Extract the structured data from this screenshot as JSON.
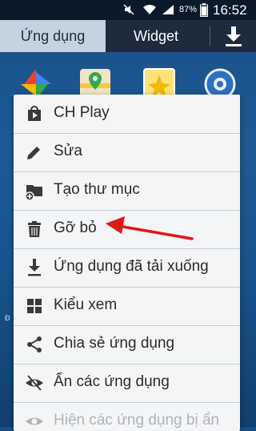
{
  "status_bar": {
    "battery_percent": "87%",
    "time": "16:52",
    "icons": [
      "mute-icon",
      "wifi-icon",
      "signal-icon",
      "battery-icon"
    ]
  },
  "tabs": [
    {
      "label": "Ứng dụng",
      "selected": true
    },
    {
      "label": "Widget",
      "selected": false
    }
  ],
  "download_button": {
    "icon": "download-icon"
  },
  "background_apps": [
    "photos-icon",
    "maps-icon",
    "gallery-icon",
    "settings-icon"
  ],
  "edge_label": "Đ",
  "menu": {
    "items": [
      {
        "label": "CH Play",
        "icon": "play-store-icon"
      },
      {
        "label": "Sửa",
        "icon": "pencil-icon"
      },
      {
        "label": "Tạo thư mục",
        "icon": "folder-add-icon"
      },
      {
        "label": "Gỡ bỏ",
        "icon": "trash-icon"
      },
      {
        "label": "Ứng dụng đã tải xuống",
        "icon": "download-icon"
      },
      {
        "label": "Kiểu xem",
        "icon": "grid-icon"
      },
      {
        "label": "Chia sẻ ứng dụng",
        "icon": "share-icon"
      },
      {
        "label": "Ẩn các ứng dụng",
        "icon": "eye-hide-icon"
      },
      {
        "label": "Hiện các ứng dụng bị ẩn",
        "icon": "eye-icon"
      }
    ]
  },
  "annotation": {
    "color": "#e01818",
    "points_to": "Gỡ bỏ"
  }
}
